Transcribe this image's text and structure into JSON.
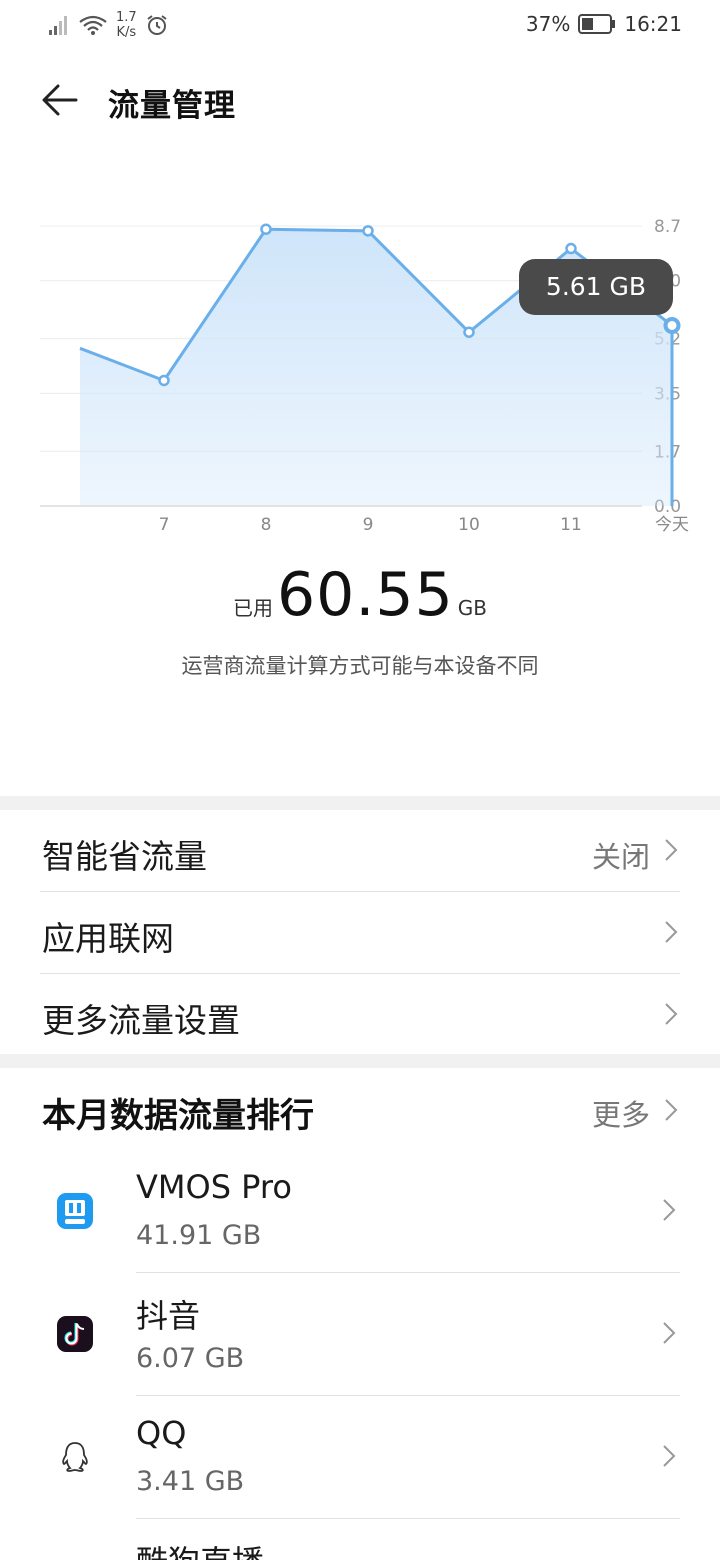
{
  "status_bar": {
    "speed_value": "1.7",
    "speed_unit": "K/s",
    "battery_percent": "37%",
    "time": "16:21"
  },
  "header": {
    "title": "流量管理"
  },
  "chart_data": {
    "type": "area",
    "x_labels": [
      "",
      "7",
      "8",
      "9",
      "10",
      "11",
      "今天"
    ],
    "values": [
      4.9,
      3.9,
      8.6,
      8.55,
      5.4,
      8.0,
      5.61
    ],
    "y_ticks": [
      "8.7",
      "7.0",
      "5.2",
      "3.5",
      "1.7",
      "0.0"
    ],
    "ylim": [
      0,
      8.7
    ],
    "grid": true,
    "selected_point_label": "5.61 GB",
    "line_color": "#6aaeea",
    "fill_color": "#cfe5fa"
  },
  "summary": {
    "used_label": "已用",
    "used_value": "60.55",
    "used_unit": "GB",
    "note": "运营商流量计算方式可能与本设备不同"
  },
  "settings": {
    "smart_saver_label": "智能省流量",
    "smart_saver_value": "关闭",
    "app_network_label": "应用联网",
    "more_settings_label": "更多流量设置"
  },
  "ranking": {
    "title": "本月数据流量排行",
    "more_label": "更多",
    "apps": [
      {
        "name": "VMOS Pro",
        "size": "41.91 GB",
        "icon": "vmos-pro-icon"
      },
      {
        "name": "抖音",
        "size": "6.07 GB",
        "icon": "douyin-icon"
      },
      {
        "name": "QQ",
        "size": "3.41 GB",
        "icon": "qq-icon"
      },
      {
        "name": "酷狗直播",
        "size": "",
        "icon": "kugou-live-icon"
      }
    ]
  }
}
